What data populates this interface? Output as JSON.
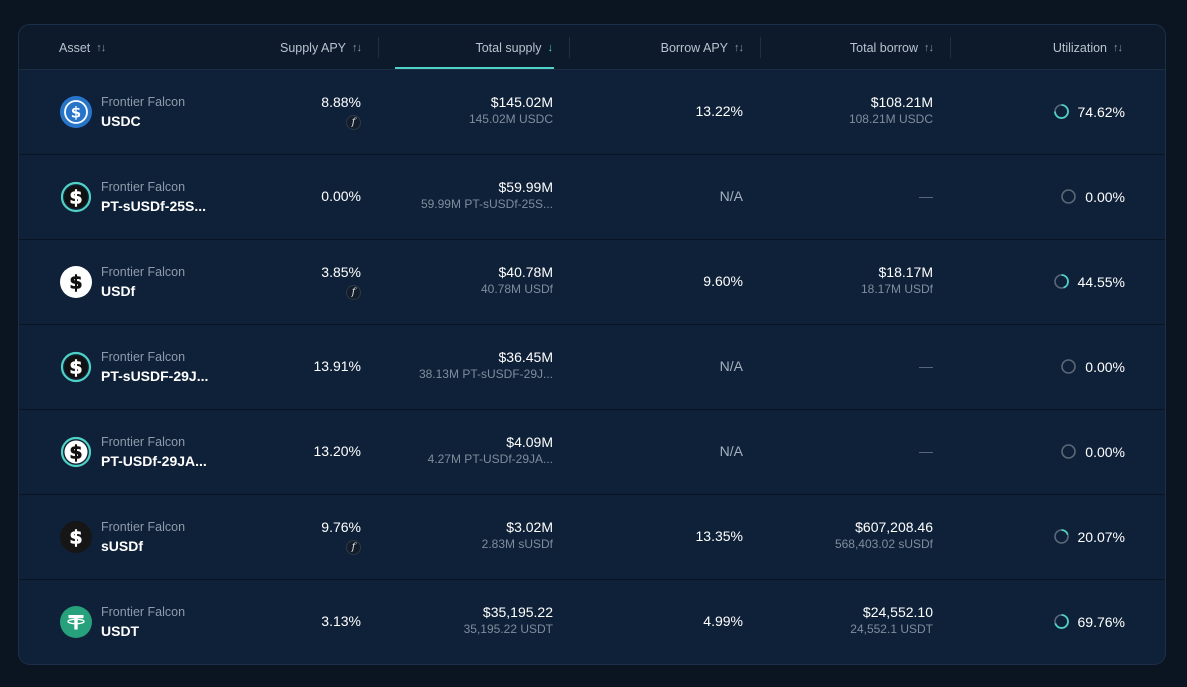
{
  "columns": {
    "asset": "Asset",
    "supply_apy": "Supply APY",
    "total_supply": "Total supply",
    "borrow_apy": "Borrow APY",
    "total_borrow": "Total borrow",
    "utilization": "Utilization"
  },
  "colors": {
    "accent": "#4fd1c5",
    "card_bg": "#0f2138",
    "page_bg": "#0b1521"
  },
  "rows": [
    {
      "icon": "usdc-icon",
      "platform": "Frontier Falcon",
      "symbol": "USDC",
      "supply_apy": "8.88%",
      "supply_badge": "f",
      "total_supply": "$145.02M",
      "total_supply_sub": "145.02M USDC",
      "borrow_apy": "13.22%",
      "total_borrow": "$108.21M",
      "total_borrow_sub": "108.21M USDC",
      "utilization": "74.62%",
      "utilization_value": 0.7462
    },
    {
      "icon": "pt-susdf-icon",
      "platform": "Frontier Falcon",
      "symbol": "PT-sUSDf-25S...",
      "supply_apy": "0.00%",
      "supply_badge": "",
      "total_supply": "$59.99M",
      "total_supply_sub": "59.99M PT-sUSDf-25S...",
      "borrow_apy": "N/A",
      "total_borrow": "—",
      "total_borrow_sub": "",
      "utilization": "0.00%",
      "utilization_value": 0
    },
    {
      "icon": "usdf-icon",
      "platform": "Frontier Falcon",
      "symbol": "USDf",
      "supply_apy": "3.85%",
      "supply_badge": "f",
      "total_supply": "$40.78M",
      "total_supply_sub": "40.78M USDf",
      "borrow_apy": "9.60%",
      "total_borrow": "$18.17M",
      "total_borrow_sub": "18.17M USDf",
      "utilization": "44.55%",
      "utilization_value": 0.4455
    },
    {
      "icon": "pt-susdf-icon",
      "platform": "Frontier Falcon",
      "symbol": "PT-sUSDF-29J...",
      "supply_apy": "13.91%",
      "supply_badge": "",
      "total_supply": "$36.45M",
      "total_supply_sub": "38.13M PT-sUSDF-29J...",
      "borrow_apy": "N/A",
      "total_borrow": "—",
      "total_borrow_sub": "",
      "utilization": "0.00%",
      "utilization_value": 0
    },
    {
      "icon": "pt-usdf-icon",
      "platform": "Frontier Falcon",
      "symbol": "PT-USDf-29JA...",
      "supply_apy": "13.20%",
      "supply_badge": "",
      "total_supply": "$4.09M",
      "total_supply_sub": "4.27M PT-USDf-29JA...",
      "borrow_apy": "N/A",
      "total_borrow": "—",
      "total_borrow_sub": "",
      "utilization": "0.00%",
      "utilization_value": 0
    },
    {
      "icon": "susdf-icon",
      "platform": "Frontier Falcon",
      "symbol": "sUSDf",
      "supply_apy": "9.76%",
      "supply_badge": "f",
      "total_supply": "$3.02M",
      "total_supply_sub": "2.83M sUSDf",
      "borrow_apy": "13.35%",
      "total_borrow": "$607,208.46",
      "total_borrow_sub": "568,403.02 sUSDf",
      "utilization": "20.07%",
      "utilization_value": 0.2007
    },
    {
      "icon": "usdt-icon",
      "platform": "Frontier Falcon",
      "symbol": "USDT",
      "supply_apy": "3.13%",
      "supply_badge": "",
      "total_supply": "$35,195.22",
      "total_supply_sub": "35,195.22 USDT",
      "borrow_apy": "4.99%",
      "total_borrow": "$24,552.10",
      "total_borrow_sub": "24,552.1 USDT",
      "utilization": "69.76%",
      "utilization_value": 0.6976
    }
  ]
}
